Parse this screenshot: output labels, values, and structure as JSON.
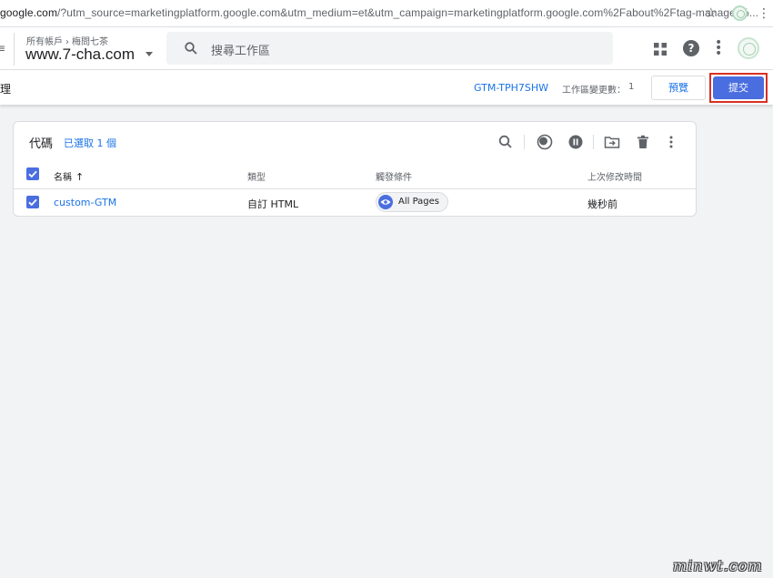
{
  "browser": {
    "url_host": "google.com",
    "url_path": "/?utm_source=marketingplatform.google.com&utm_medium=et&utm_campaign=marketingplatform.google.com%2Fabout%2Ftag-manager%..."
  },
  "header": {
    "breadcrumb_account": "所有帳戶",
    "breadcrumb_sep": "›",
    "breadcrumb_container": "梅問七茶",
    "container_name": "www.7-cha.com",
    "search_placeholder": "搜尋工作區"
  },
  "workspace": {
    "nav_label": "理",
    "container_id": "GTM-TPH7SHW",
    "changes_label": "工作區變更數：",
    "changes_count": "1",
    "preview_label": "預覽",
    "submit_label": "提交"
  },
  "tags_card": {
    "title": "代碼",
    "selected_count": "已選取 1 個",
    "columns": {
      "name": "名稱",
      "type": "類型",
      "trigger": "觸發條件",
      "last_edited": "上次修改時間"
    },
    "rows": [
      {
        "name": "custom-GTM",
        "type": "自訂 HTML",
        "trigger": "All Pages",
        "last_edited": "幾秒前"
      }
    ]
  },
  "watermark": "minwt.com",
  "colors": {
    "accent": "#1a73e8",
    "primary_button": "#4a6ee0",
    "highlight_outline": "#d93025"
  }
}
